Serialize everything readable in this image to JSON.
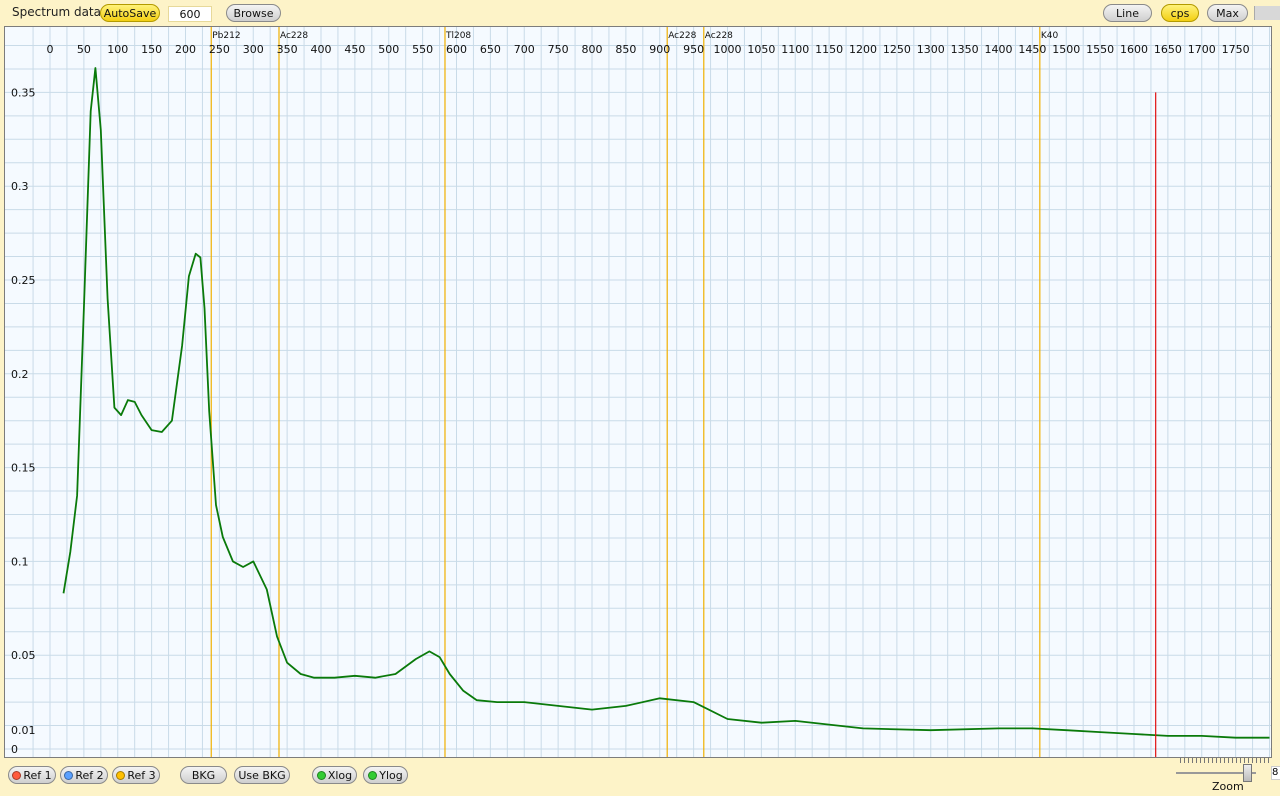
{
  "toolbar": {
    "title": "Spectrum data",
    "autosave_label": "AutoSave",
    "interval_value": "600",
    "browse_label": "Browse",
    "line_label": "Line",
    "cps_label": "cps",
    "max_label": "Max"
  },
  "bottom": {
    "ref1_label": "Ref 1",
    "ref2_label": "Ref 2",
    "ref3_label": "Ref 3",
    "bkg_label": "BKG",
    "use_bkg_label": "Use BKG",
    "xlog_label": "Xlog",
    "ylog_label": "Ylog",
    "zoom_label": "Zoom",
    "zoom_value": "8"
  },
  "colors": {
    "curve": "#0a7a0a",
    "marker": "#f0b000",
    "cursor": "#e01010",
    "grid": "#c9dbe8",
    "ref1_dot": "#ff5a3c",
    "ref2_dot": "#5aa0ff",
    "ref3_dot": "#ffc000",
    "log_dot": "#33cc33"
  },
  "chart_data": {
    "type": "line",
    "title": "",
    "xlabel": "",
    "ylabel": "",
    "xlim": [
      -40,
      1800
    ],
    "ylim": [
      0,
      0.38
    ],
    "x_ticks": [
      "0",
      "50",
      "100",
      "150",
      "200",
      "250",
      "300",
      "350",
      "400",
      "450",
      "500",
      "550",
      "600",
      "650",
      "700",
      "750",
      "800",
      "850",
      "900",
      "950",
      "1000",
      "1050",
      "1100",
      "1150",
      "1200",
      "1250",
      "1300",
      "1350",
      "1400",
      "1450",
      "1500",
      "1550",
      "1600",
      "1650",
      "1700",
      "1750"
    ],
    "y_ticks": [
      "0",
      "0.01",
      "0.05",
      "0.1",
      "0.15",
      "0.2",
      "0.25",
      "0.3",
      "0.35"
    ],
    "grid": true,
    "series": [
      {
        "x": [
          20,
          30,
          40,
          50,
          60,
          67,
          75,
          85,
          95,
          105,
          115,
          125,
          135,
          150,
          165,
          180,
          195,
          205,
          215,
          222,
          228,
          235,
          245,
          255,
          270,
          285,
          300,
          320,
          335,
          350,
          370,
          390,
          420,
          450,
          480,
          510,
          540,
          560,
          575,
          590,
          610,
          630,
          660,
          700,
          750,
          800,
          850,
          900,
          950,
          1000,
          1050,
          1100,
          1150,
          1200,
          1300,
          1400,
          1450,
          1500,
          1550,
          1600,
          1650,
          1700,
          1750,
          1800
        ],
        "y": [
          0.083,
          0.105,
          0.135,
          0.235,
          0.34,
          0.363,
          0.33,
          0.24,
          0.182,
          0.178,
          0.186,
          0.185,
          0.178,
          0.17,
          0.169,
          0.175,
          0.215,
          0.252,
          0.264,
          0.262,
          0.235,
          0.18,
          0.13,
          0.113,
          0.1,
          0.097,
          0.1,
          0.085,
          0.06,
          0.046,
          0.04,
          0.038,
          0.038,
          0.039,
          0.038,
          0.04,
          0.048,
          0.052,
          0.049,
          0.04,
          0.031,
          0.026,
          0.025,
          0.025,
          0.023,
          0.021,
          0.023,
          0.027,
          0.025,
          0.016,
          0.014,
          0.015,
          0.013,
          0.011,
          0.01,
          0.011,
          0.011,
          0.01,
          0.009,
          0.008,
          0.007,
          0.007,
          0.006,
          0.006
        ]
      }
    ],
    "markers": [
      {
        "label": "Pb212",
        "x": 238
      },
      {
        "label": "Ac228",
        "x": 338
      },
      {
        "label": "Tl208",
        "x": 583
      },
      {
        "label": "Ac228",
        "x": 911
      },
      {
        "label": "Ac228",
        "x": 965
      },
      {
        "label": "K40",
        "x": 1461
      }
    ],
    "cursor_x": 1632,
    "cursor_y_top": 0.35
  }
}
